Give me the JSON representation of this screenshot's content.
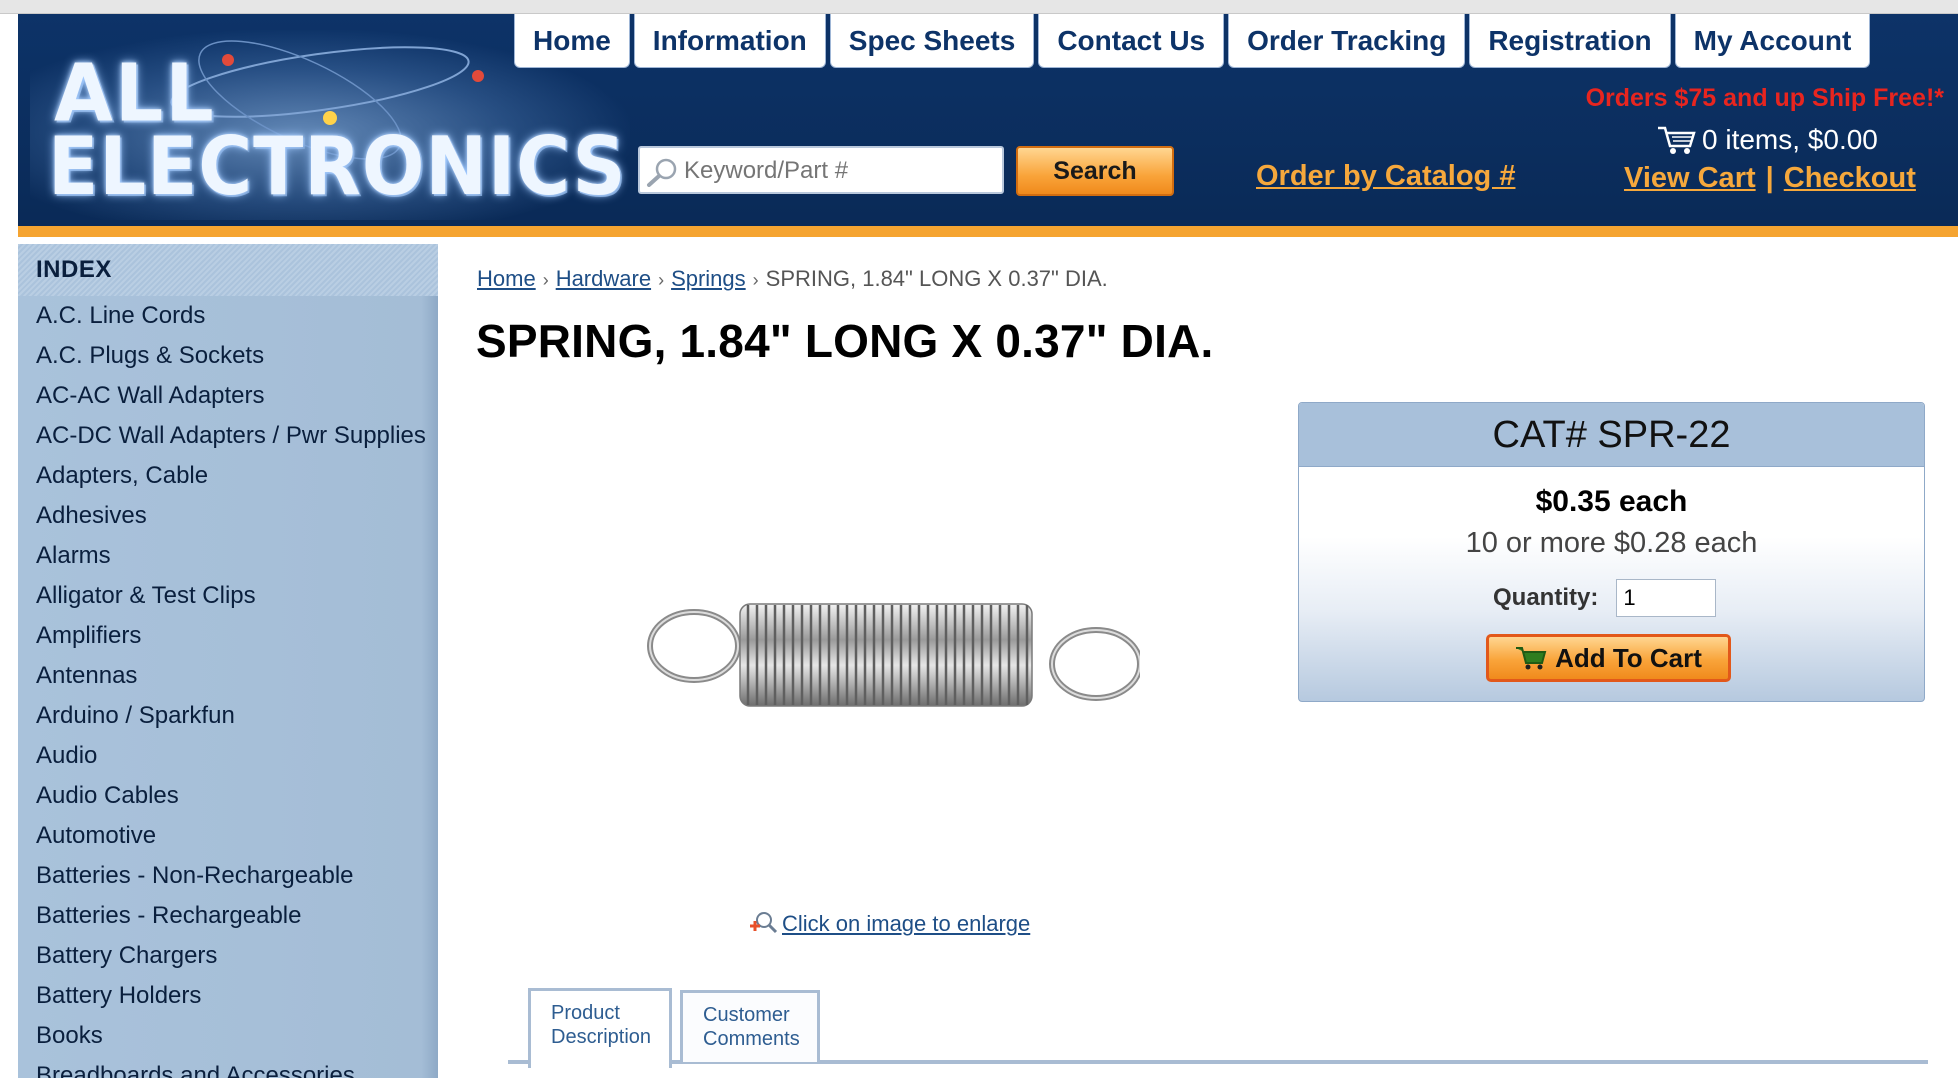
{
  "logo": {
    "line1": "ALL",
    "line2": "ELECTRONICS"
  },
  "nav": {
    "tabs": [
      "Home",
      "Information",
      "Spec Sheets",
      "Contact Us",
      "Order Tracking",
      "Registration",
      "My Account"
    ]
  },
  "search": {
    "placeholder": "Keyword/Part #",
    "button": "Search"
  },
  "order_by_catalog": "Order by Catalog #",
  "shipping_banner": "Orders $75 and up Ship Free!*",
  "cart": {
    "summary": "0 items, $0.00",
    "view_cart": "View Cart",
    "separator": "|",
    "checkout": "Checkout"
  },
  "sidebar": {
    "header": "INDEX",
    "items": [
      "A.C. Line Cords",
      "A.C. Plugs & Sockets",
      "AC-AC Wall Adapters",
      "AC-DC Wall Adapters / Pwr Supplies",
      "Adapters, Cable",
      "Adhesives",
      "Alarms",
      "Alligator & Test Clips",
      "Amplifiers",
      "Antennas",
      "Arduino / Sparkfun",
      "Audio",
      "Audio Cables",
      "Automotive",
      "Batteries - Non-Rechargeable",
      "Batteries - Rechargeable",
      "Battery Chargers",
      "Battery Holders",
      "Books",
      "Breadboards and Accessories"
    ]
  },
  "breadcrumb": {
    "home": "Home",
    "hardware": "Hardware",
    "springs": "Springs",
    "current": "SPRING, 1.84\" LONG X 0.37\" DIA."
  },
  "product": {
    "title": "SPRING, 1.84\" LONG X 0.37\" DIA.",
    "cat": "CAT# SPR-22",
    "price": "$0.35 each",
    "qty_price": "10 or more $0.28 each",
    "quantity_label": "Quantity:",
    "quantity_value": "1",
    "add_to_cart": "Add To Cart",
    "enlarge": "Click on image to enlarge"
  },
  "tabs": {
    "product_description": [
      "Product",
      "Description"
    ],
    "customer_comments": [
      "Customer",
      "Comments"
    ]
  },
  "colors": {
    "header_bg": "#0d3368",
    "accent_orange": "#f5a431",
    "sidebar_bg": "#a7c0d9",
    "free_ship_red": "#e8251f"
  }
}
